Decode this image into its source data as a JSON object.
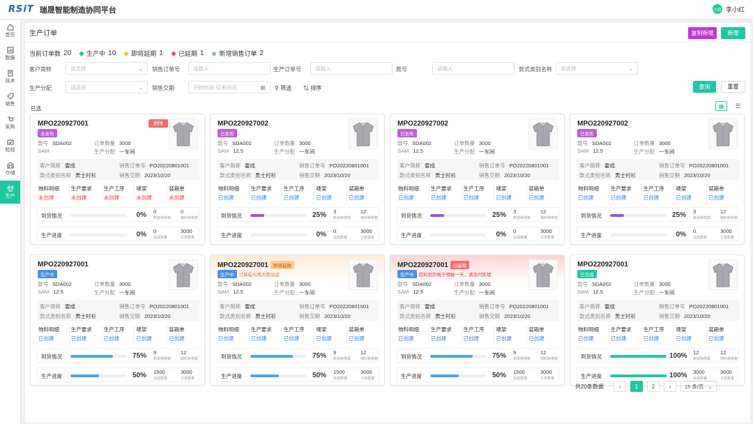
{
  "header": {
    "logo": "RSiT",
    "title": "瑞晟智能制造协同平台",
    "avatar": "小红",
    "user": "李小红"
  },
  "nav": [
    {
      "label": "首页",
      "icon": "home-icon"
    },
    {
      "label": "数据",
      "icon": "data-icon"
    },
    {
      "label": "技术",
      "icon": "tech-icon"
    },
    {
      "label": "销售",
      "icon": "sales-icon"
    },
    {
      "label": "采购",
      "icon": "cart-icon"
    },
    {
      "label": "检验",
      "icon": "inspect-icon"
    },
    {
      "label": "仓储",
      "icon": "warehouse-icon"
    },
    {
      "label": "生产",
      "icon": "production-icon"
    }
  ],
  "page": {
    "title": "生产订单",
    "copy_new": "复制新增",
    "new": "新增"
  },
  "stats": {
    "total_label": "当前订单数",
    "total": "20",
    "in_prod_label": "生产中",
    "in_prod": "10",
    "near_due_label": "即将延期",
    "near_due": "1",
    "delayed_label": "已延期",
    "delayed": "1",
    "new_sales_label": "新增销售订单",
    "new_sales": "2",
    "colors": {
      "in_prod": "#1fc7a1",
      "near_due": "#fbb54c",
      "delayed": "#f04e4e",
      "new_sales": "#8fb4f2"
    }
  },
  "filters": {
    "customer_label": "客户简称",
    "customer_ph": "请选择",
    "sales_no_label": "销售订单号",
    "sales_no_ph": "请输入",
    "prod_no_label": "生产订单号",
    "prod_no_ph": "请输入",
    "style_label": "款号",
    "style_ph": "请输入",
    "category_label": "款式类别名称",
    "category_ph": "请选择",
    "assign_label": "生产分配",
    "assign_ph": "请选择",
    "delivery_label": "销售交期",
    "delivery_ph": "开始时间-结束时间",
    "filter_btn": "筛选",
    "sort_btn": "排序",
    "query": "查询",
    "reset": "重置"
  },
  "selected_label": "已选",
  "labels": {
    "style": "款号",
    "qty": "订单数量",
    "sam": "SAM",
    "assign": "生产分配",
    "customer": "客户简称",
    "sales_no": "销售订单号",
    "category": "款式类别名称",
    "delivery": "销售交期",
    "arrival": "到货情况",
    "progress": "生产进度",
    "arrived_kinds": "到货种类数",
    "material_kinds": "物料种类数",
    "done_qty": "完成数量",
    "order_qty": "订单数量",
    "delete": "删除"
  },
  "stage_names": [
    "物料明细",
    "生产要求",
    "生产工序",
    "唛架",
    "装箱单"
  ],
  "cards": [
    {
      "no": "MPO220927001",
      "tag": "未发布",
      "tag_class": "t-purple",
      "note": "",
      "del": true,
      "style": "SDA002",
      "qty": "3000",
      "sam": "",
      "assign": "一车间",
      "customer": "雷成",
      "sales_no": "PO20220801001",
      "category": "男士衬衫",
      "delivery": "2023/10/20",
      "stage_status": [
        "未创建",
        "未创建",
        "未创建",
        "未创建",
        "未创建"
      ],
      "stage_class": "s-red",
      "arrival": 0,
      "arrival_pct": "0%",
      "arrived": "0",
      "kinds": "0",
      "progress": 0,
      "progress_pct": "0%",
      "done": "0",
      "order": "3000",
      "bar_color": "#3b86e8"
    },
    {
      "no": "MPO220927002",
      "tag": "已发布",
      "tag_class": "t-purple",
      "note": "",
      "del": false,
      "style": "SDA002",
      "qty": "3000",
      "sam": "12.5",
      "assign": "一车间",
      "customer": "雷成",
      "sales_no": "PO20220801001",
      "category": "男士衬衫",
      "delivery": "2023/10/20",
      "stage_status": [
        "已创建",
        "已创建",
        "已创建",
        "已创建",
        "已创建"
      ],
      "stage_class": "s-blue",
      "arrival": 25,
      "arrival_pct": "25%",
      "arrived": "3",
      "kinds": "12",
      "progress": 0,
      "progress_pct": "0%",
      "done": "0",
      "order": "3000",
      "bar_color": "#a050e0"
    },
    {
      "no": "MPO220927002",
      "tag": "已发布",
      "tag_class": "t-purple",
      "note": "",
      "del": false,
      "style": "SDA002",
      "qty": "3000",
      "sam": "12.5",
      "assign": "一车间",
      "customer": "雷成",
      "sales_no": "PO20220801001",
      "category": "男士衬衫",
      "delivery": "2023/10/20",
      "stage_status": [
        "已创建",
        "已创建",
        "已创建",
        "已创建",
        "已创建"
      ],
      "stage_class": "s-blue",
      "arrival": 25,
      "arrival_pct": "25%",
      "arrived": "3",
      "kinds": "12",
      "progress": 0,
      "progress_pct": "0%",
      "done": "0",
      "order": "3000",
      "bar_color": "#a050e0"
    },
    {
      "no": "MPO220927002",
      "tag": "已发布",
      "tag_class": "t-purple",
      "note": "",
      "del": false,
      "style": "SDA002",
      "qty": "3000",
      "sam": "12.5",
      "assign": "一车间",
      "customer": "雷成",
      "sales_no": "PO20220801001",
      "category": "男士衬衫",
      "delivery": "2023/10/20",
      "stage_status": [
        "已创建",
        "已创建",
        "已创建",
        "已创建",
        "已创建"
      ],
      "stage_class": "s-blue",
      "arrival": 25,
      "arrival_pct": "25%",
      "arrived": "3",
      "kinds": "12",
      "progress": 0,
      "progress_pct": "0%",
      "done": "0",
      "order": "3000",
      "bar_color": "#a050e0"
    },
    {
      "no": "MPO220927001",
      "tag": "生产中",
      "tag_class": "t-blue",
      "note": "",
      "del": false,
      "style": "SDA002",
      "qty": "3000",
      "sam": "12.5",
      "assign": "一车间",
      "customer": "雷成",
      "sales_no": "PO20220801001",
      "category": "男士衬衫",
      "delivery": "2023/10/20",
      "stage_status": [
        "已创建",
        "已创建",
        "已创建",
        "已创建",
        "已创建"
      ],
      "stage_class": "s-blue",
      "arrival": 75,
      "arrival_pct": "75%",
      "arrived": "9",
      "kinds": "12",
      "progress": 50,
      "progress_pct": "50%",
      "done": "1500",
      "order": "3000",
      "bar_color": "#4aa3ee"
    },
    {
      "no": "MPO220927001",
      "tag": "即将延期",
      "tag_class": "t-orange",
      "status": "生产中",
      "note": "订单临与两天即出运",
      "note_class": "",
      "del": false,
      "style": "SDA002",
      "qty": "3000",
      "sam": "12.5",
      "assign": "一车间",
      "customer": "雷成",
      "sales_no": "PO20220801001",
      "category": "男士衬衫",
      "delivery": "2023/10/20",
      "stage_status": [
        "已创建",
        "已创建",
        "已创建",
        "已创建",
        "已创建"
      ],
      "stage_class": "s-blue",
      "arrival": 75,
      "arrival_pct": "75%",
      "arrived": "9",
      "kinds": "12",
      "progress": 50,
      "progress_pct": "50%",
      "done": "1500",
      "order": "3000",
      "bar_color": "#4aa3ee",
      "card_class": "warn"
    },
    {
      "no": "MPO220927001",
      "tag": "已延期",
      "tag_class": "t-red",
      "status": "生产中",
      "note": "首料到货晚于预报一天，请及时处理",
      "note_class": "red",
      "del": false,
      "style": "SDA002",
      "qty": "3000",
      "sam": "12.5",
      "assign": "一车间",
      "customer": "雷成",
      "sales_no": "PO20220801001",
      "category": "男士衬衫",
      "delivery": "2023/10/20",
      "stage_status": [
        "已创建",
        "已创建",
        "已创建",
        "已创建",
        "已创建"
      ],
      "stage_class": "s-blue",
      "arrival": 75,
      "arrival_pct": "75%",
      "arrived": "9",
      "kinds": "12",
      "progress": 50,
      "progress_pct": "50%",
      "done": "1500",
      "order": "3000",
      "bar_color": "#4aa3ee",
      "card_class": "late"
    },
    {
      "no": "MPO220927001",
      "tag": "已完成",
      "tag_class": "t-green",
      "note": "",
      "del": false,
      "style": "SDA002",
      "qty": "3000",
      "sam": "12.5",
      "assign": "一车间",
      "customer": "雷成",
      "sales_no": "PO20220801001",
      "category": "男士衬衫",
      "delivery": "2023/10/20",
      "stage_status": [
        "已创建",
        "已创建",
        "已创建",
        "已创建",
        "已创建"
      ],
      "stage_class": "s-blue",
      "arrival": 100,
      "arrival_pct": "100%",
      "arrived": "12",
      "kinds": "12",
      "progress": 100,
      "progress_pct": "100%",
      "done": "3000",
      "order": "3000",
      "bar_color": "#1fc7a1"
    }
  ],
  "pager": {
    "total": "共20条数据",
    "pages": [
      "1",
      "2"
    ],
    "current": "1",
    "size": "15 条/页",
    "prev": "‹",
    "next": "›"
  }
}
